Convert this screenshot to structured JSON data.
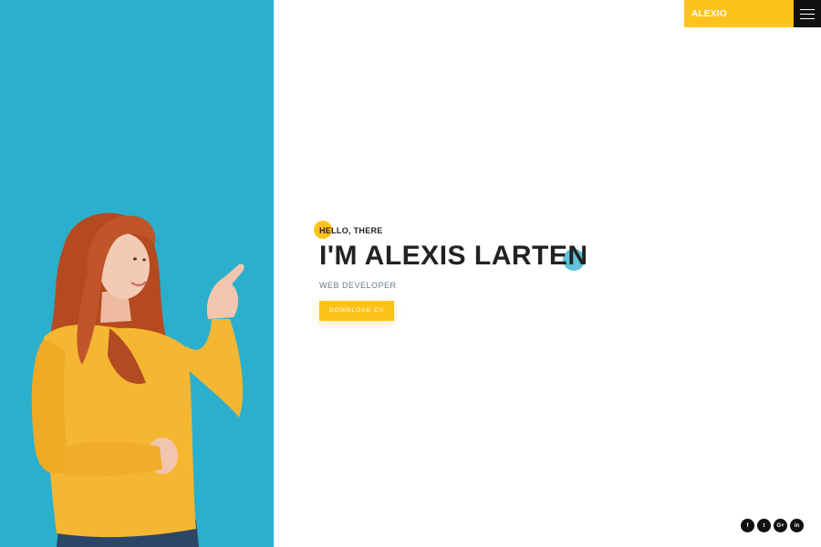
{
  "header": {
    "brand": "ALEXIO",
    "menu_icon": "hamburger-icon"
  },
  "hero": {
    "greeting": "HELLO, THERE",
    "name": "I'M ALEXIS LARTEN",
    "role": "WEB DEVELOPER",
    "cta_label": "DOWNLOAD CV"
  },
  "social": {
    "facebook": "f",
    "twitter": "t",
    "google_plus": "G+",
    "linkedin": "in"
  },
  "colors": {
    "accent_yellow": "#fec31a",
    "accent_blue": "#2bafcd",
    "dark": "#111111"
  }
}
